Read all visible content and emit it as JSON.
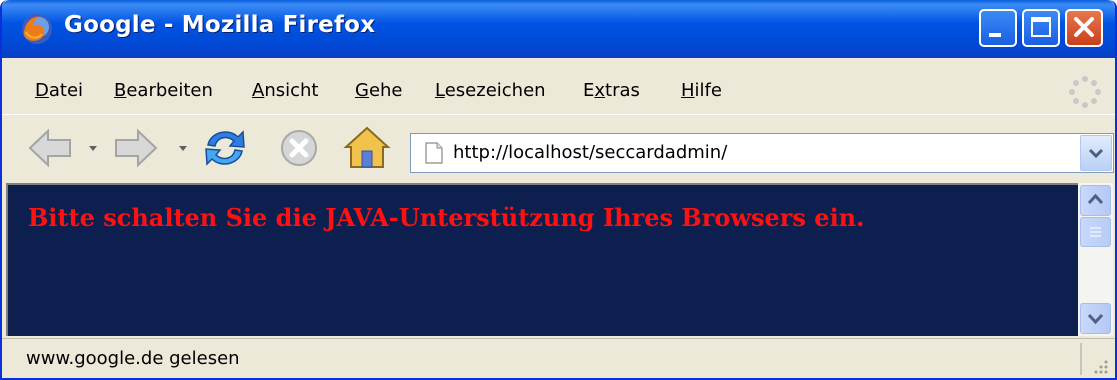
{
  "window": {
    "title": "Google - Mozilla Firefox",
    "icon": "firefox-icon"
  },
  "menu": {
    "items": [
      {
        "label": "Datei",
        "accel": "D"
      },
      {
        "label": "Bearbeiten",
        "accel": "B"
      },
      {
        "label": "Ansicht",
        "accel": "A"
      },
      {
        "label": "Gehe",
        "accel": "G"
      },
      {
        "label": "Lesezeichen",
        "accel": "L"
      },
      {
        "label": "Extras",
        "accel": "x"
      },
      {
        "label": "Hilfe",
        "accel": "H"
      }
    ]
  },
  "toolbar": {
    "buttons": [
      "back-icon",
      "forward-icon",
      "reload-icon",
      "stop-icon",
      "home-icon"
    ]
  },
  "address": {
    "url": "http://localhost/seccardadmin/"
  },
  "content": {
    "message": "Bitte schalten Sie die JAVA-Unterstützung Ihres Browsers ein.",
    "background": "#0c1f4f",
    "text_color": "#ff1111"
  },
  "status": {
    "text": "www.google.de gelesen"
  },
  "colors": {
    "titlebar": "#0054e3",
    "chrome": "#ece9d8",
    "close": "#c9401a"
  }
}
